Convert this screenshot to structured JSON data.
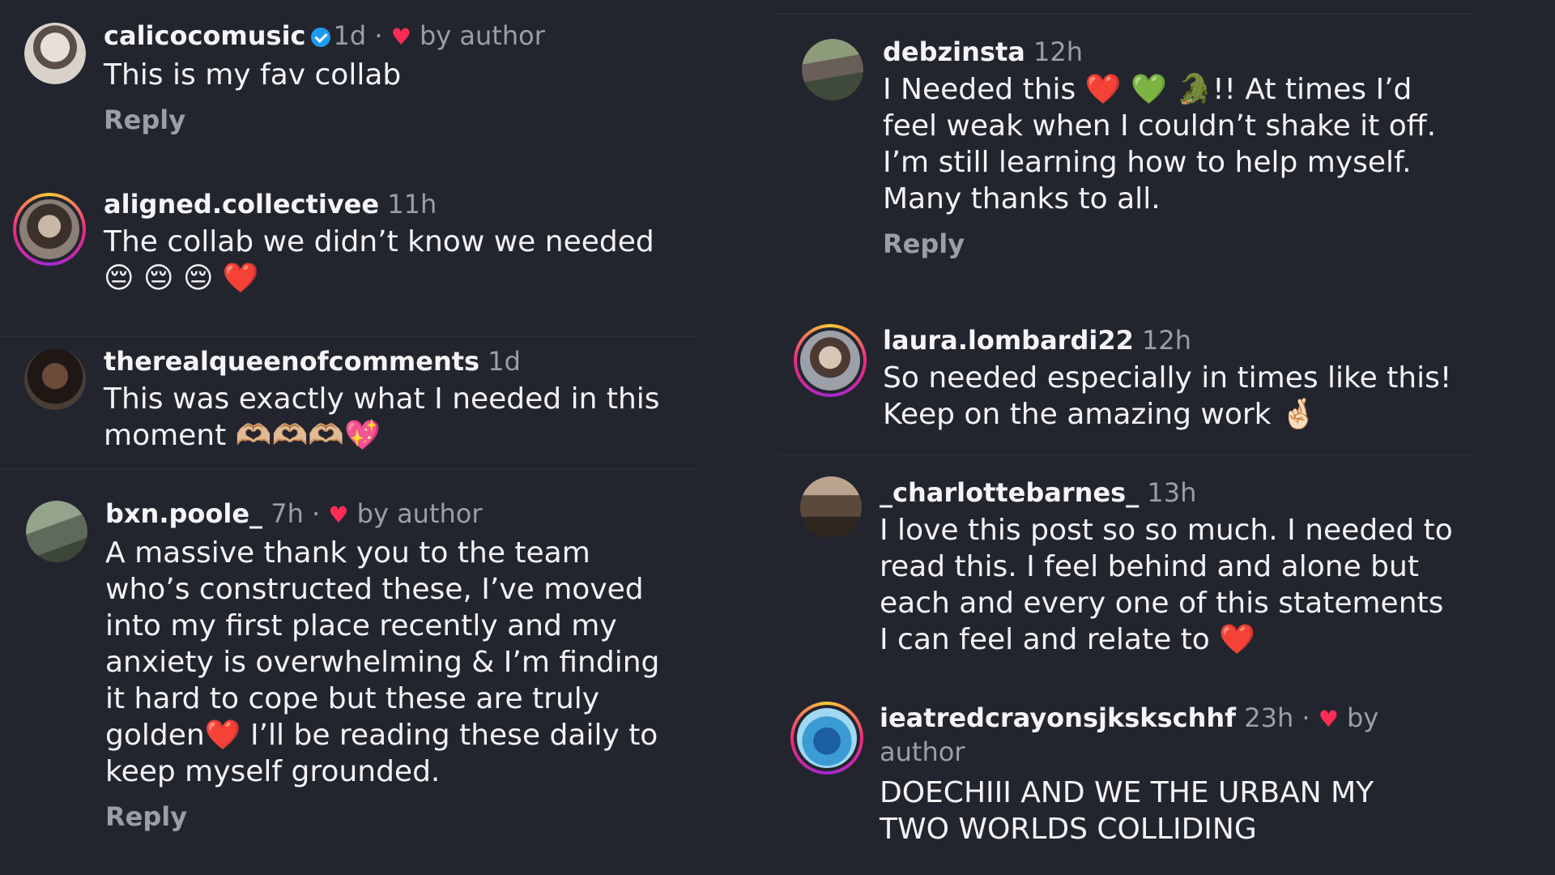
{
  "left": [
    {
      "username": "calicocomusic",
      "verified": true,
      "time": "1d",
      "liked_by_author": true,
      "liked_label": "by author",
      "text": "This is my fav collab",
      "emojis": "",
      "reply_label": "Reply",
      "avatar_color": "#c9c2b8"
    },
    {
      "username": "aligned.collectivee",
      "time": "11h",
      "text": "The collab we didn’t know we needed",
      "emojis": "😔 😔 😔 ❤️",
      "avatar_color": "#5d5149"
    },
    {
      "username": "therealqueenofcomments",
      "time": "1d",
      "text": "This was exactly what I needed in this moment",
      "emojis": "🫶🏼🫶🏼🫶🏼💖",
      "avatar_color": "#3a2c25"
    },
    {
      "username": "bxn.poole_",
      "time": "7h",
      "liked_by_author": true,
      "liked_label": "by author",
      "text_lines": [
        "A massive thank you to the team",
        "who’s constructed these, I’ve moved",
        "into my first place recently and my",
        "anxiety is overwhelming & I’m finding",
        "it hard to cope but these are truly",
        "golden❤️  I’ll be reading these daily to",
        "keep myself grounded."
      ],
      "reply_label": "Reply",
      "avatar_color": "#6e7a6a"
    }
  ],
  "right": [
    {
      "username": "debzinsta",
      "time": "12h",
      "text_lines": [
        "I Needed this ❤️ 💚 🐊!! At times I’d",
        "feel weak when I couldn’t shake it off.",
        "I’m still learning how to help myself.",
        "Many thanks to all."
      ],
      "reply_label": "Reply",
      "avatar_color": "#6a6a55"
    },
    {
      "username": "laura.lombardi22",
      "time": "12h",
      "text_lines": [
        "So needed especially in times like this!",
        "Keep on the amazing work 🤞🏻"
      ],
      "avatar_color": "#8a8a95"
    },
    {
      "username": "_charlottebarnes_",
      "time": "13h",
      "text_lines": [
        "I love this post so so much. I needed to",
        "read this. I feel behind and alone but",
        "each and every one of this statements",
        "I can feel and relate to ❤️"
      ],
      "avatar_color": "#5b4a3c"
    },
    {
      "username": "ieatredcrayonsjkskschhf",
      "time": "23h",
      "liked_by_author": true,
      "liked_label_1": "by",
      "liked_label_2": "author",
      "text_lines": [
        "DOECHIII AND WE THE URBAN MY",
        "TWO WORLDS COLLIDING"
      ],
      "avatar_color": "#2a7fb8"
    }
  ]
}
